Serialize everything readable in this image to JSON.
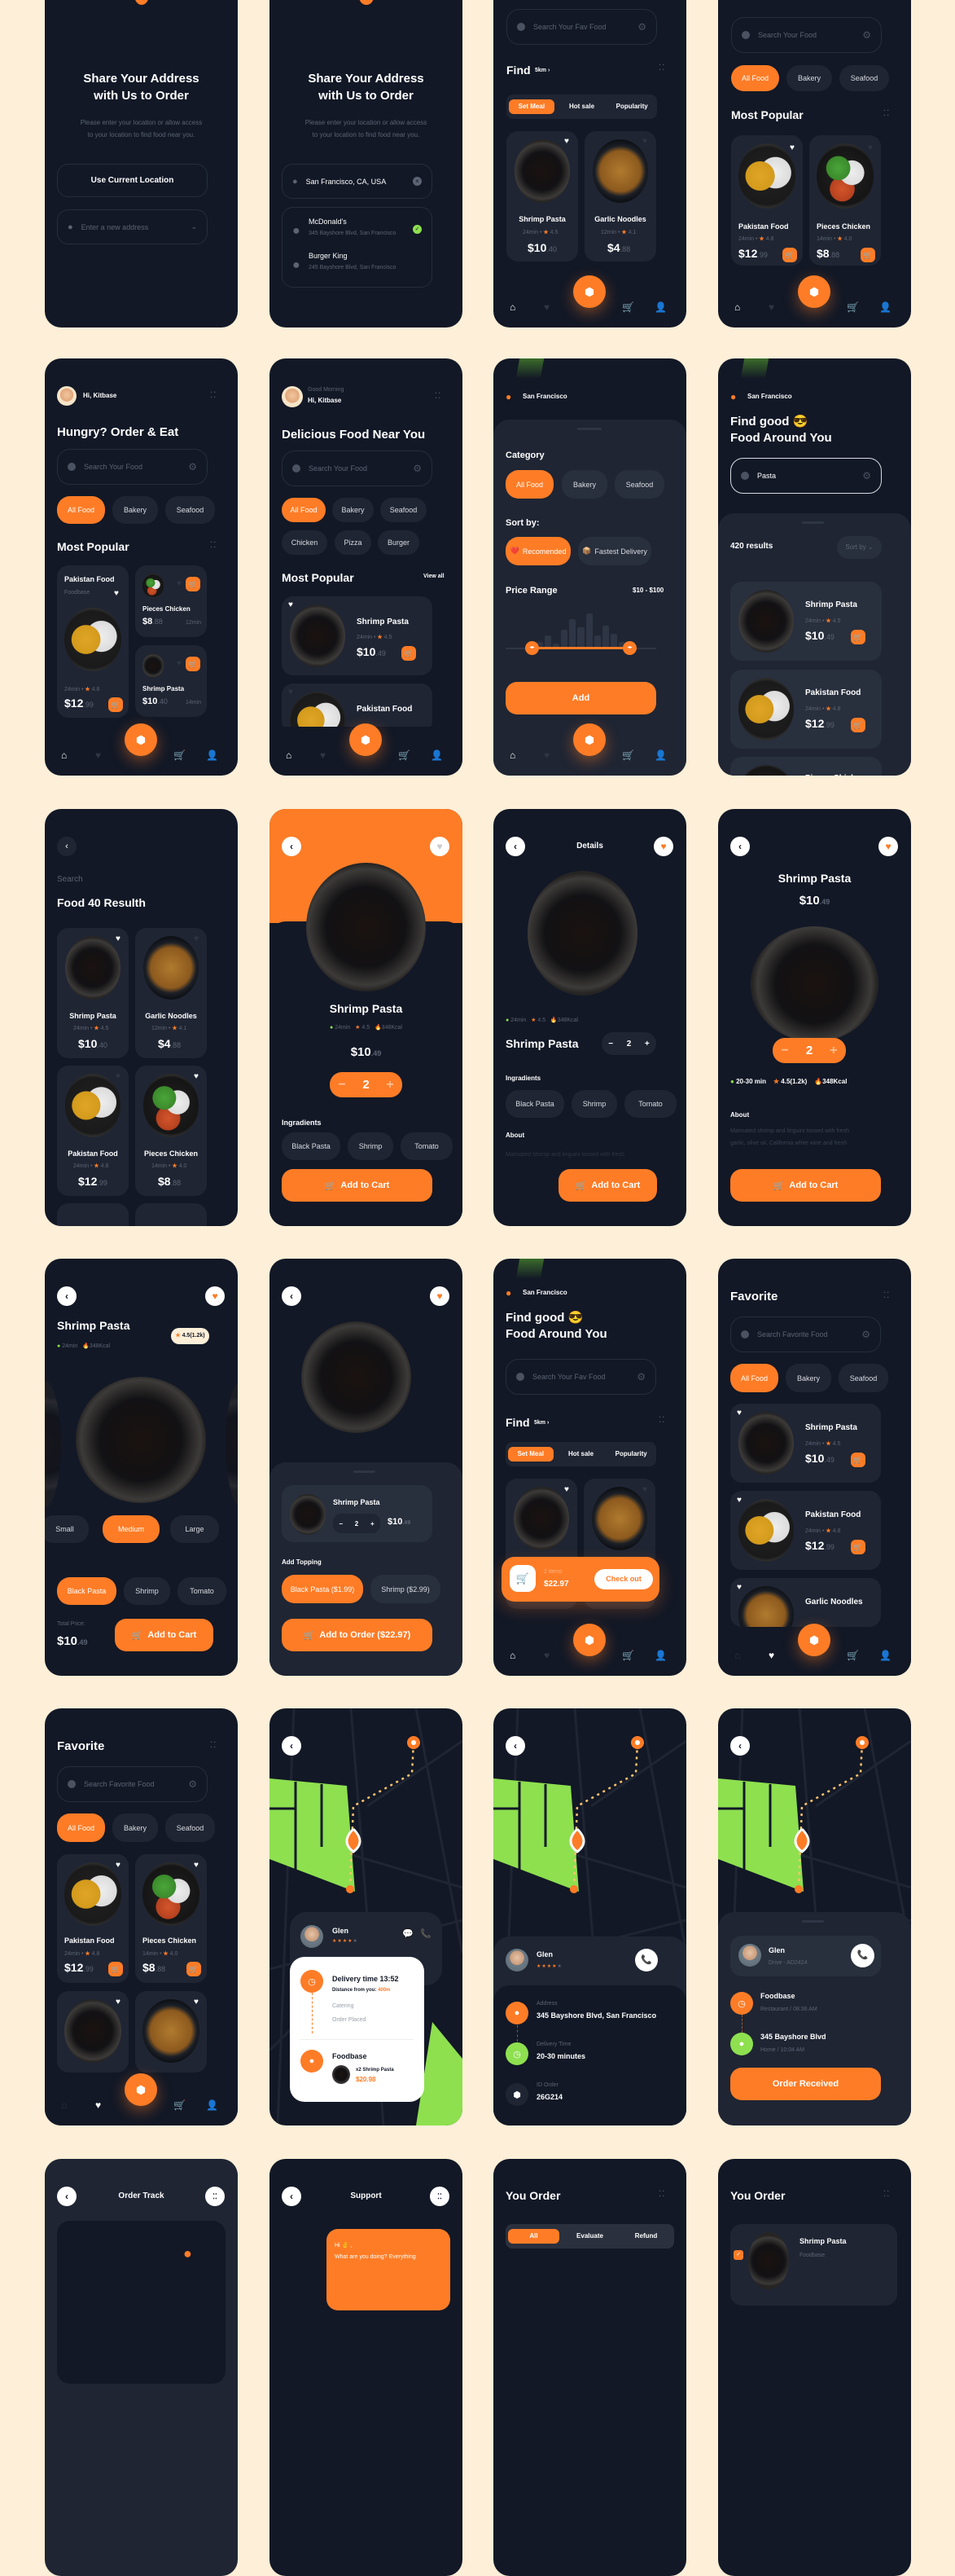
{
  "colors": {
    "background": "#feefd8",
    "screen": "#121826",
    "card": "#1f2533",
    "accent": "#fe7c26",
    "green": "#8ee04f"
  },
  "icons": {
    "search": "search-icon",
    "filter": "gear-icon",
    "heart": "heart-icon",
    "cart": "cart-icon",
    "home": "home-icon",
    "profile": "user-icon",
    "box": "box-icon",
    "back": "chevron-left-icon",
    "pin": "location-pin-icon",
    "clock": "clock-icon",
    "star": "star-icon",
    "fire": "fire-icon",
    "phone": "phone-icon",
    "chat": "chat-icon",
    "menu": "grid-dots-icon"
  },
  "screens": {
    "s1": {
      "title_l1": "Share Your Address",
      "title_l2": "with Us to Order",
      "desc_l1": "Please enter your location or allow access",
      "desc_l2": "to your location to find food near you.",
      "use_location": "Use Current Location",
      "address_placeholder": "Enter a new address"
    },
    "s2": {
      "title_l1": "Share Your Address",
      "title_l2": "with Us to Order",
      "desc_l1": "Please enter your location or allow access",
      "desc_l2": "to your location to find food near you.",
      "address_value": "San Francisco, CA, USA",
      "results": [
        {
          "name": "McDonald's",
          "addr": "345 Bayshore Blvd, San Francisco",
          "selected": true
        },
        {
          "name": "Burger King",
          "addr": "245 Bayshore Blvd, San Francisco",
          "selected": false
        }
      ]
    },
    "s3": {
      "search_placeholder": "Search Your Fav Food",
      "find": "Find",
      "distance": "5km ›",
      "tabs": [
        "Set Meal",
        "Hot sale",
        "Popularity"
      ],
      "items": [
        {
          "name": "Shrimp Pasta",
          "time": "24min •",
          "rating": "4.5",
          "price": "$10",
          "cents": ".40"
        },
        {
          "name": "Garlic Noodles",
          "time": "12min •",
          "rating": "4.1",
          "price": "$4",
          "cents": ".88"
        }
      ]
    },
    "s4": {
      "search_placeholder": "Search Your Food",
      "chips": [
        "All Food",
        "Bakery",
        "Seafood"
      ],
      "section": "Most Popular",
      "items": [
        {
          "name": "Pakistan Food",
          "time": "24min •",
          "rating": "4.8",
          "price": "$12",
          "cents": ".99"
        },
        {
          "name": "Pieces Chicken",
          "time": "14min •",
          "rating": "4.0",
          "price": "$8",
          "cents": ".88"
        }
      ]
    },
    "s5": {
      "greeting": "Hi, Kitbase",
      "title": "Hungry? Order & Eat",
      "search_placeholder": "Search Your Food",
      "chips": [
        "All Food",
        "Bakery",
        "Seafood"
      ],
      "section": "Most Popular",
      "big": {
        "name": "Pakistan Food",
        "vendor": "Foodbase",
        "time": "24min •",
        "rating": "4.8",
        "price": "$12",
        "cents": ".99"
      },
      "small": [
        {
          "name": "Pieces Chicken",
          "price": "$8",
          "cents": ".88",
          "time": "12min"
        },
        {
          "name": "Shrimp Pasta",
          "price": "$10",
          "cents": ".40",
          "time": "14min"
        }
      ]
    },
    "s6": {
      "salutation": "Good Morning",
      "greeting": "Hi, Kitbase",
      "title": "Delicious Food Near You",
      "search_placeholder": "Search Your Food",
      "chips": [
        "All Food",
        "Bakery",
        "Seafood",
        "Chicken",
        "Pizza",
        "Burger"
      ],
      "section": "Most Popular",
      "view_all": "View all",
      "items": [
        {
          "name": "Shrimp Pasta",
          "time": "24min •",
          "rating": "4.5",
          "price": "$10",
          "cents": ".49"
        },
        {
          "name": "Pakistan Food"
        }
      ]
    },
    "s7": {
      "location": "San Francisco",
      "category": "Category",
      "chips": [
        "All Food",
        "Bakery",
        "Seafood"
      ],
      "sort_by": "Sort by:",
      "sort_chips": [
        "Recomended",
        "Fastest Delivery"
      ],
      "price_range": "Price Range",
      "range_value": "$10 - $100",
      "range_min": 10,
      "range_max": 100,
      "histogram": [
        0.15,
        0.3,
        0.1,
        0.45,
        0.7,
        0.5,
        0.85,
        0.3,
        0.55,
        0.35,
        0.15
      ],
      "add": "Add"
    },
    "s8": {
      "location": "San Francisco",
      "title_l1": "Find good 😎",
      "title_l2": "Food Around You",
      "search_value": "Pasta",
      "results": "420 results",
      "sort": "Sort by",
      "items": [
        {
          "name": "Shrimp Pasta",
          "time": "24min •",
          "rating": "4.5",
          "price": "$10",
          "cents": ".49"
        },
        {
          "name": "Pakistan Food",
          "time": "24min •",
          "rating": "4.8",
          "price": "$12",
          "cents": ".99"
        },
        {
          "name": "Pieces Chicken"
        }
      ]
    },
    "s9": {
      "label": "Search",
      "title": "Food 40 Resulth",
      "items": [
        {
          "name": "Shrimp Pasta",
          "time": "24min •",
          "rating": "4.5",
          "price": "$10",
          "cents": ".40"
        },
        {
          "name": "Garlic Noodles",
          "time": "12min •",
          "rating": "4.1",
          "price": "$4",
          "cents": ".88"
        },
        {
          "name": "Pakistan Food",
          "time": "24min •",
          "rating": "4.8",
          "price": "$12",
          "cents": ".99"
        },
        {
          "name": "Pieces Chicken",
          "time": "14min •",
          "rating": "4.0",
          "price": "$8",
          "cents": ".88"
        }
      ]
    },
    "s10": {
      "name": "Shrimp Pasta",
      "time": "24min",
      "rating": "4.5",
      "kcal": "348Kcal",
      "price": "$10",
      "cents": ".49",
      "qty": "2",
      "ingredients_label": "Ingradients",
      "ingredients": [
        "Black Pasta",
        "Shrimp",
        "Tomato"
      ],
      "add": "Add to Cart"
    },
    "s11": {
      "header": "Details",
      "time": "24min",
      "rating": "4.5",
      "kcal": "348Kcal",
      "name": "Shrimp Pasta",
      "qty": "2",
      "ingredients_label": "Ingradients",
      "ingredients": [
        "Black Pasta",
        "Shrimp",
        "Tomato"
      ],
      "about": "About",
      "about_text": "Marinated shrimp and linguini tossed with fresh",
      "add": "Add to Cart"
    },
    "s12": {
      "name": "Shrimp Pasta",
      "price": "$10",
      "cents": ".49",
      "qty": "2",
      "time": "20-30 min",
      "rating": "4.5(1.2k)",
      "kcal": "348Kcal",
      "about": "About",
      "about_l1": "Marinated shrimp and linguini tossed with fresh",
      "about_l2": "garlic, olive oil, California white wine and fresh",
      "add": "Add to Cart"
    },
    "s13": {
      "name": "Shrimp Pasta",
      "time": "24min",
      "kcal": "348Kcal",
      "rating": "4.5(1.2k)",
      "sizes": [
        "Small",
        "Medium",
        "Large"
      ],
      "toppings": [
        "Black Pasta",
        "Shrimp",
        "Tomato"
      ],
      "total_label": "Total Price:",
      "price": "$10",
      "cents": ".49",
      "add": "Add to Cart"
    },
    "s14": {
      "name": "Shrimp Pasta",
      "qty": "2",
      "price": "$10",
      "cents": ".49",
      "topping_label": "Add Topping",
      "toppings": [
        "Black Pasta ($1.99)",
        "Shrimp ($2.99)"
      ],
      "add": "Add to Order ($22.97)"
    },
    "s15": {
      "location": "San Francisco",
      "title_l1": "Find good 😎",
      "title_l2": "Food Around You",
      "search_placeholder": "Search Your Fav Food",
      "find": "Find",
      "distance": "5km ›",
      "tabs": [
        "Set Meal",
        "Hot sale",
        "Popularity"
      ],
      "cart_items": "2 items",
      "cart_total": "$22.97",
      "checkout": "Check out"
    },
    "s16": {
      "title": "Favorite",
      "search_placeholder": "Search Favorite Food",
      "chips": [
        "All Food",
        "Bakery",
        "Seafood"
      ],
      "items": [
        {
          "name": "Shrimp Pasta",
          "time": "24min •",
          "rating": "4.5",
          "price": "$10",
          "cents": ".49"
        },
        {
          "name": "Pakistan Food",
          "time": "24min •",
          "rating": "4.8",
          "price": "$12",
          "cents": ".99"
        },
        {
          "name": "Garlic Noodles"
        }
      ]
    },
    "s17": {
      "title": "Favorite",
      "search_placeholder": "Search Favorite Food",
      "chips": [
        "All Food",
        "Bakery",
        "Seafood"
      ],
      "items": [
        {
          "name": "Pakistan Food",
          "time": "24min •",
          "rating": "4.8",
          "price": "$12",
          "cents": ".99"
        },
        {
          "name": "Pieces Chicken",
          "time": "14min •",
          "rating": "4.0",
          "price": "$8",
          "cents": ".88"
        }
      ]
    },
    "s18": {
      "driver": "Glen",
      "driver_rating": 4,
      "delivery_time": "Delivery time 13:52",
      "distance_label": "Distance from you:",
      "distance": "400m",
      "steps": [
        "Catering",
        "Order Placed"
      ],
      "vendor": "Foodbase",
      "order_item": "x2 Shrimp Pasta",
      "order_price": "$20.98"
    },
    "s19": {
      "driver": "Glen",
      "driver_rating": 4,
      "address_label": "Address",
      "address": "345 Bayshore Blvd, San Francisco",
      "time_label": "Delivery Time",
      "time": "20-30 minutes",
      "id_label": "ID Order",
      "id": "26G214"
    },
    "s20": {
      "driver": "Glen",
      "driver_sub": "Drive - AD2424",
      "from": "Foodbase",
      "from_sub": "Restaurant / 08:36 AM",
      "to": "345 Bayshore Blvd",
      "to_sub": "Home / 10:04 AM",
      "btn": "Order Received"
    },
    "s21": {
      "title": "Order Track"
    },
    "s22": {
      "title": "Support",
      "msg_l1": "Hi ✌️ ,",
      "msg_l2": "What are you doing? Everything"
    },
    "s23": {
      "title": "You Order",
      "tabs": [
        "All",
        "Evaluate",
        "Refund"
      ]
    },
    "s24": {
      "title": "You Order",
      "item": "Shrimp Pasta",
      "vendor": "Foodbase"
    }
  }
}
